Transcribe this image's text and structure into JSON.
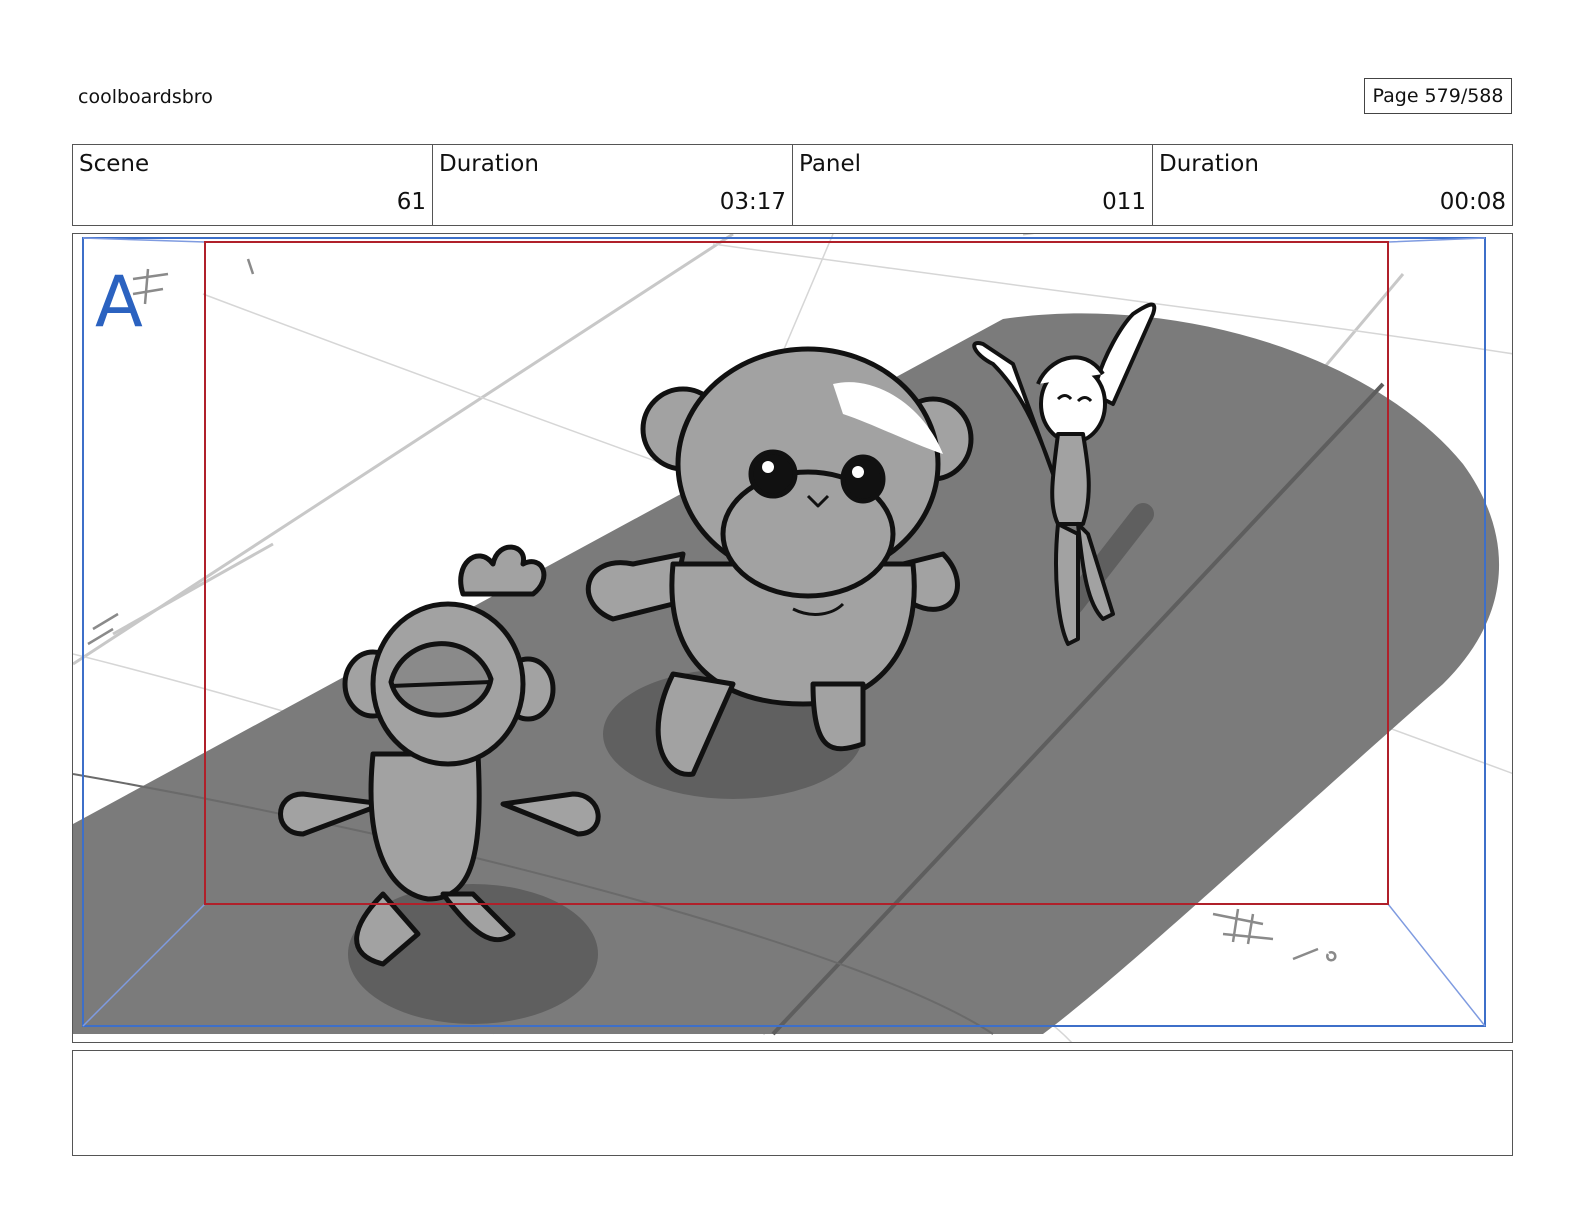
{
  "header": {
    "title": "coolboardsbro",
    "page": "Page 579/588"
  },
  "info": {
    "scene_label": "Scene",
    "scene_value": "61",
    "scene_duration_label": "Duration",
    "scene_duration_value": "03:17",
    "panel_label": "Panel",
    "panel_value": "011",
    "panel_duration_label": "Duration",
    "panel_duration_value": "00:08"
  },
  "panel": {
    "marker": "A",
    "marker_color": "#2b62c0",
    "safe_frame_color": "#b0202a",
    "camera_frame_color": "#3d6fc9",
    "description": "Sketch of three characters on a dark runway: a chick-like creature, a teddy bear, and a girl with raised arms"
  },
  "notes": {
    "text": ""
  }
}
